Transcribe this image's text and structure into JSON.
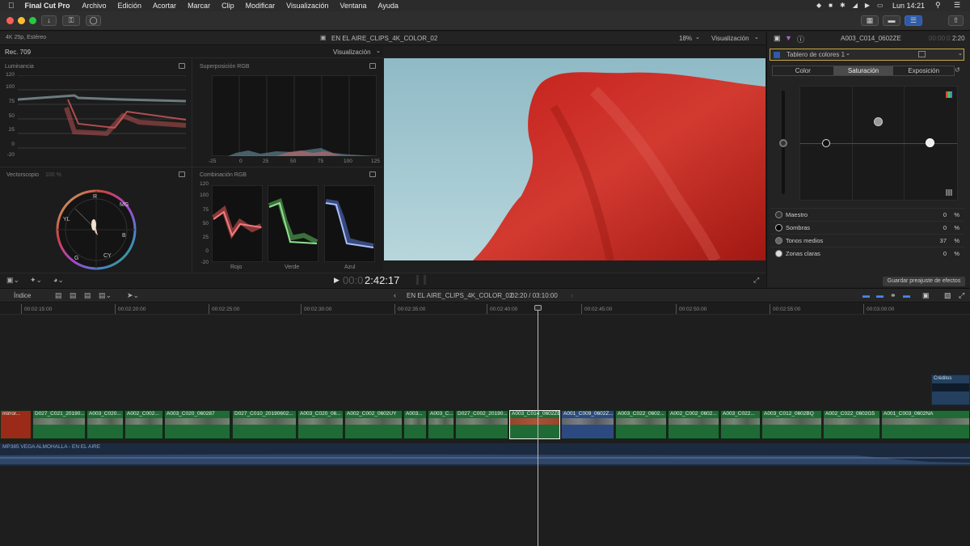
{
  "menubar": {
    "app": "Final Cut Pro",
    "items": [
      "Archivo",
      "Edición",
      "Acortar",
      "Marcar",
      "Clip",
      "Modificar",
      "Visualización",
      "Ventana",
      "Ayuda"
    ],
    "clock": "Lun 14:21"
  },
  "viewer_header": {
    "format": "4K 25p, Estéreo",
    "title": "EN EL AIRE_CLIPS_4K_COLOR_02",
    "zoom": "18%",
    "view_menu": "Visualización"
  },
  "scopes": {
    "standard": "Rec. 709",
    "view_menu": "Visualización",
    "luminance": {
      "title": "Luminancia",
      "ticks": [
        "120",
        "100",
        "75",
        "50",
        "25",
        "0",
        "-20"
      ]
    },
    "rgb_overlay": {
      "title": "Superposición RGB",
      "xticks": [
        "-25",
        "0",
        "25",
        "50",
        "75",
        "100",
        "125"
      ]
    },
    "vectorscope": {
      "title": "Vectorscopio",
      "percent": "100 %",
      "labels": [
        "R",
        "MG",
        "YL",
        "B",
        "G",
        "CY"
      ]
    },
    "rgb_parade": {
      "title": "Combinación RGB",
      "ticks": [
        "120",
        "100",
        "75",
        "50",
        "25",
        "0",
        "-20"
      ],
      "channels": [
        "Rojo",
        "Verde",
        "Azul"
      ]
    }
  },
  "transport": {
    "timecode_dim": "00:0",
    "timecode": "2:42:17"
  },
  "inspector": {
    "clip_name": "A003_C014_0602ZE",
    "duration_dim": "00:00:0",
    "duration": "2:20",
    "effect_name": "Tablero de colores 1",
    "tabs": [
      "Color",
      "Saturación",
      "Exposición"
    ],
    "active_tab": "Saturación",
    "rows": [
      {
        "name": "Maestro",
        "value": "0",
        "unit": "%"
      },
      {
        "name": "Sombras",
        "value": "0",
        "unit": "%"
      },
      {
        "name": "Tonos medios",
        "value": "37",
        "unit": "%"
      },
      {
        "name": "Zonas claras",
        "value": "0",
        "unit": "%"
      }
    ],
    "save_preset": "Guardar preajuste de efectos"
  },
  "timeline": {
    "index_label": "Índice",
    "project": "EN EL AIRE_CLIPS_4K_COLOR_02",
    "position": "02:20 / 03:10:00",
    "ruler": [
      "00:02:15:00",
      "00:02:20:00",
      "00:02:25:00",
      "00:02:30:00",
      "00:02:35:00",
      "00:02:40:00",
      "00:02:45:00",
      "00:02:50:00",
      "00:02:55:00",
      "00:03:00:00"
    ],
    "clips": [
      "mirror...",
      "D027_C021_20190...",
      "A003_C020...",
      "A002_C002...",
      "A003_C020_060287",
      "D027_C010_20190602...",
      "A003_C020_06...",
      "A002_C002_0602UY",
      "A003...",
      "A003_C...",
      "D027_C002_20190...",
      "A003_C014_0602ZE",
      "A001_C009_0602Z...",
      "A003_C022_0602...",
      "A002_C002_0602...",
      "A003_C022...",
      "A003_C012_0602BQ",
      "A002_C022_0602G5",
      "A001_C003_0602NA"
    ],
    "connected_clip": "Créditos",
    "audio_label": "MP385 VEGA ALMOHALLA - EN EL AIRE"
  }
}
